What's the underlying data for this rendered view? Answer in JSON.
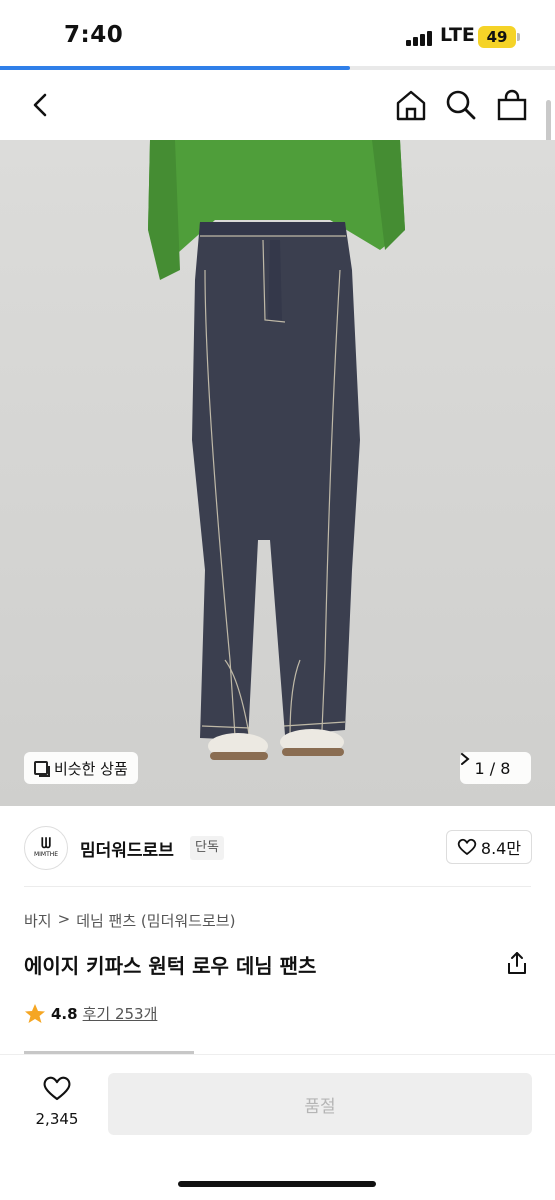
{
  "status_bar": {
    "time": "7:40",
    "network": "LTE",
    "battery": "49"
  },
  "loading": {
    "progress": 0.63
  },
  "header": {
    "back_icon": "chevron-left-icon",
    "home_icon": "home-icon",
    "search_icon": "search-icon",
    "cart_icon": "shopping-bag-icon"
  },
  "gallery": {
    "similar_label": "비슷한 상품",
    "current": "1",
    "total": "8",
    "pager_text": "1 / 8"
  },
  "brand": {
    "logo_text": "ᗯ",
    "logo_sub": "MIMTHE",
    "name": "밈더워드로브",
    "badge": "단독",
    "likes": "8.4만"
  },
  "product": {
    "breadcrumb": [
      "바지",
      "데님 팬츠 (밈더워드로브)"
    ],
    "title": "에이지 키파스 원턱 로우 데님 팬츠",
    "rating": "4.8",
    "reviews": "후기 253개"
  },
  "bottom": {
    "heart_count": "2,345",
    "buy_label": "품절"
  },
  "colors": {
    "accent": "#2f7fe9",
    "star": "#f5a623",
    "battery": "#f5d327"
  }
}
